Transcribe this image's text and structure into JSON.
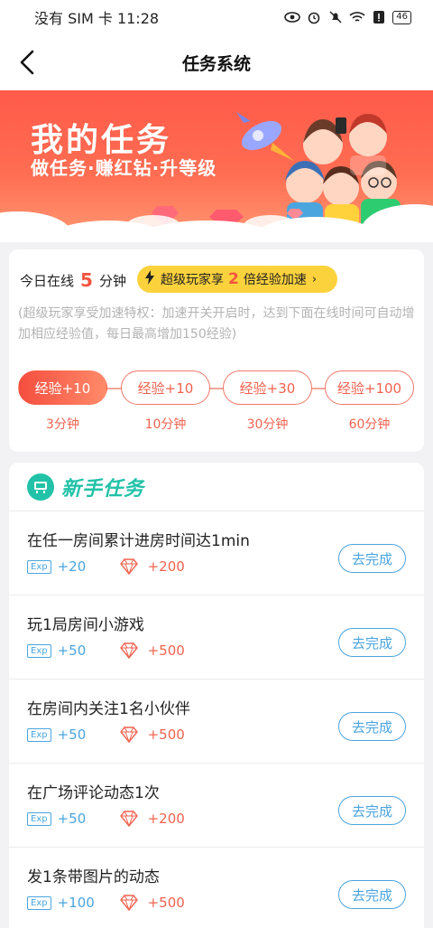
{
  "status_bar": {
    "carrier_time": "没有 SIM 卡 11:28",
    "battery": "46"
  },
  "nav": {
    "title": "任务系统"
  },
  "banner": {
    "title": "我的任务",
    "subtitle": "做任务·赚红钻·升等级"
  },
  "online": {
    "prefix": "今日在线",
    "minutes": "5",
    "suffix": "分钟",
    "boost_prefix": "超级玩家享",
    "boost_multiplier": "2",
    "boost_suffix": "倍经验加速",
    "description": "(超级玩家享受加速特权：加速开关开启时，达到下面在线时间可自动增加相应经验值，每日最高增加150经验)",
    "levels": [
      {
        "exp": "经验+10",
        "time": "3分钟"
      },
      {
        "exp": "经验+10",
        "time": "10分钟"
      },
      {
        "exp": "经验+30",
        "time": "30分钟"
      },
      {
        "exp": "经验+100",
        "time": "60分钟"
      }
    ]
  },
  "tasks": {
    "title": "新手任务",
    "exp_badge": "Exp",
    "button_label": "去完成",
    "items": [
      {
        "name": "在任一房间累计进房时间达1min",
        "exp": "+20",
        "gem": "+200"
      },
      {
        "name": "玩1局房间小游戏",
        "exp": "+50",
        "gem": "+500"
      },
      {
        "name": "在房间内关注1名小伙伴",
        "exp": "+50",
        "gem": "+500"
      },
      {
        "name": "在广场评论动态1次",
        "exp": "+50",
        "gem": "+200"
      },
      {
        "name": "发1条带图片的动态",
        "exp": "+100",
        "gem": "+500"
      }
    ]
  },
  "colors": {
    "accent_red": "#f2543f",
    "teal": "#21c2a8",
    "blue": "#4aa5df",
    "boost_yellow": "#fcd23c"
  }
}
